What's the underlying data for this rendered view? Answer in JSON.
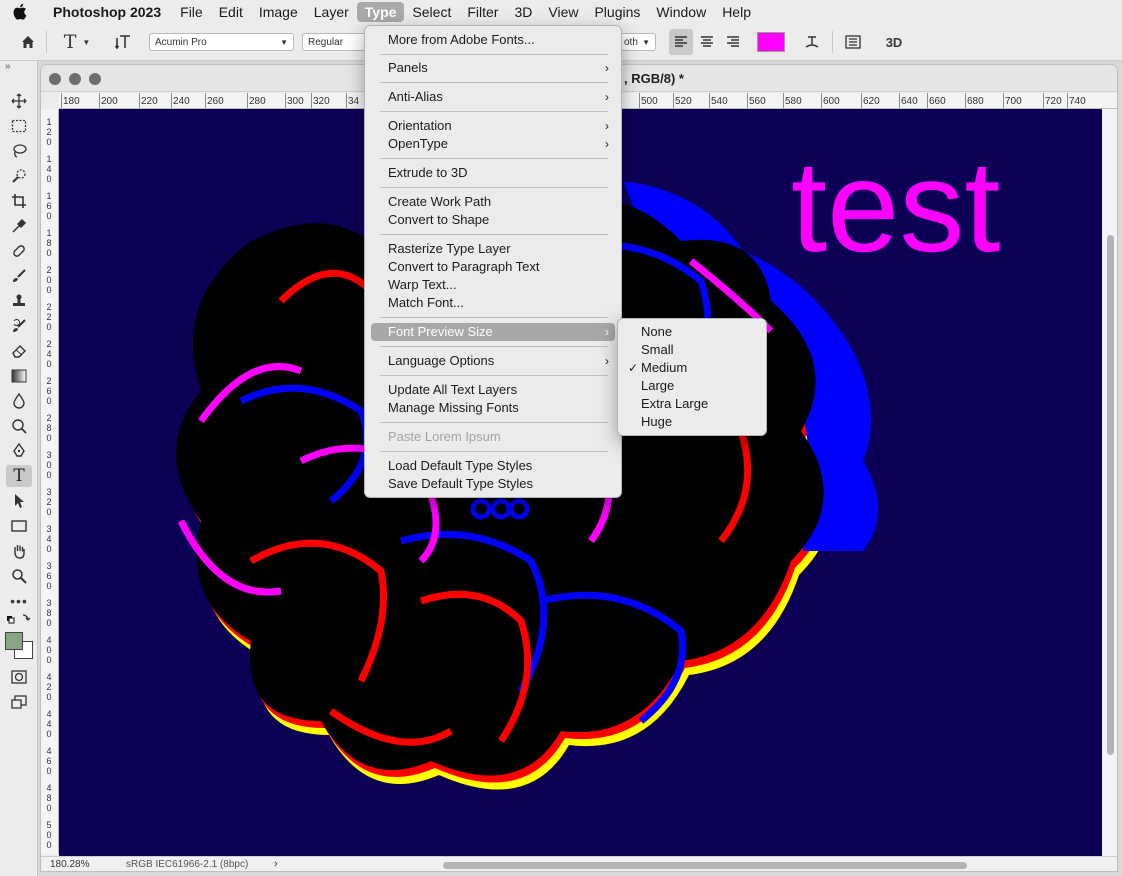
{
  "menubar": {
    "apple_icon": "apple-logo",
    "app_name": "Photoshop 2023",
    "items": [
      "File",
      "Edit",
      "Image",
      "Layer",
      "Type",
      "Select",
      "Filter",
      "3D",
      "View",
      "Plugins",
      "Window",
      "Help"
    ],
    "active_item": "Type"
  },
  "options_bar": {
    "font_family": "Acumin Pro",
    "font_style": "Regular",
    "antialias_partial": "oth",
    "text_color": "#ff00ff",
    "mode_3d": "3D"
  },
  "document": {
    "title_visible": ", RGB/8) *",
    "zoom": "180.28%",
    "color_profile": "sRGB IEC61966-2.1 (8bpc)",
    "status_arrow": "›"
  },
  "ruler": {
    "h_labels": [
      "180",
      "200",
      "220",
      "240",
      "260",
      "280",
      "300",
      "320",
      "34",
      "500",
      "520",
      "540",
      "560",
      "580",
      "600",
      "620",
      "640",
      "660",
      "680",
      "700",
      "720",
      "740"
    ],
    "v_labels": [
      "120",
      "140",
      "160",
      "180",
      "200",
      "220",
      "240",
      "260",
      "280",
      "300",
      "320",
      "340",
      "360",
      "380",
      "400",
      "420",
      "440",
      "460",
      "480",
      "500"
    ]
  },
  "canvas": {
    "background": "#0c0056",
    "text_layer": "test",
    "text_color": "#ff00ff"
  },
  "type_menu": {
    "items": [
      {
        "label": "More from Adobe Fonts...",
        "submenu": false
      },
      {
        "label": "Panels",
        "submenu": true
      },
      {
        "label": "Anti-Alias",
        "submenu": true
      },
      {
        "label": "Orientation",
        "submenu": true
      },
      {
        "label": "OpenType",
        "submenu": true
      },
      {
        "label": "Extrude to 3D",
        "submenu": false
      },
      {
        "label": "Create Work Path",
        "submenu": false
      },
      {
        "label": "Convert to Shape",
        "submenu": false
      },
      {
        "label": "Rasterize Type Layer",
        "submenu": false
      },
      {
        "label": "Convert to Paragraph Text",
        "submenu": false
      },
      {
        "label": "Warp Text...",
        "submenu": false
      },
      {
        "label": "Match Font...",
        "submenu": false
      },
      {
        "label": "Font Preview Size",
        "submenu": true,
        "highlighted": true
      },
      {
        "label": "Language Options",
        "submenu": true
      },
      {
        "label": "Update All Text Layers",
        "submenu": false
      },
      {
        "label": "Manage Missing Fonts",
        "submenu": false
      },
      {
        "label": "Paste Lorem Ipsum",
        "submenu": false,
        "disabled": true
      },
      {
        "label": "Load Default Type Styles",
        "submenu": false
      },
      {
        "label": "Save Default Type Styles",
        "submenu": false
      }
    ]
  },
  "font_preview_submenu": {
    "items": [
      "None",
      "Small",
      "Medium",
      "Large",
      "Extra Large",
      "Huge"
    ],
    "checked": "Medium",
    "check_mark": "✓"
  },
  "chevron": "›"
}
